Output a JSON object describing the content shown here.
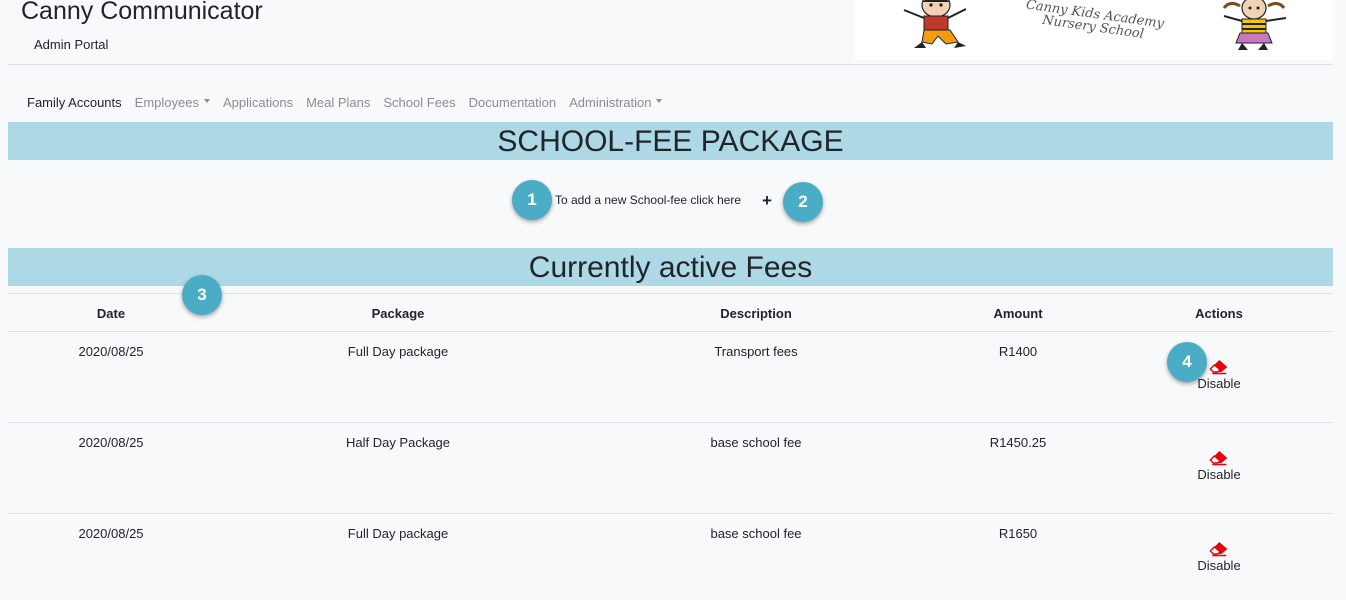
{
  "header": {
    "app_title": "Canny Communicator",
    "subtitle": "Admin Portal",
    "banner_text_line1": "Canny Kids Academy",
    "banner_text_line2": "Nursery School"
  },
  "nav": {
    "items": [
      {
        "label": "Family Accounts",
        "active": true,
        "dropdown": false
      },
      {
        "label": "Employees",
        "active": false,
        "dropdown": true
      },
      {
        "label": "Applications",
        "active": false,
        "dropdown": false
      },
      {
        "label": "Meal Plans",
        "active": false,
        "dropdown": false
      },
      {
        "label": "School Fees",
        "active": false,
        "dropdown": false
      },
      {
        "label": "Documentation",
        "active": false,
        "dropdown": false
      },
      {
        "label": "Administration",
        "active": false,
        "dropdown": true
      }
    ]
  },
  "page": {
    "title": "SCHOOL-FEE PACKAGE",
    "add_text": "To add a new School-fee click here",
    "add_icon": "+",
    "section_title": "Currently active Fees"
  },
  "markers": [
    "1",
    "2",
    "3",
    "4"
  ],
  "table": {
    "headers": [
      "Date",
      "Package",
      "Description",
      "Amount",
      "Actions"
    ],
    "rows": [
      {
        "date": "2020/08/25",
        "package": "Full Day package",
        "description": "Transport fees",
        "amount": "R1400",
        "action": "Disable"
      },
      {
        "date": "2020/08/25",
        "package": "Half Day Package",
        "description": "base school fee",
        "amount": "R1450.25",
        "action": "Disable"
      },
      {
        "date": "2020/08/25",
        "package": "Full Day package",
        "description": "base school fee",
        "amount": "R1650",
        "action": "Disable"
      }
    ]
  },
  "colors": {
    "banner_bg": "#add8e6",
    "marker_bg": "#4bacc6",
    "eraser_icon": "#e8000b"
  },
  "icons": {
    "add": "plus-icon",
    "disable": "eraser-icon"
  }
}
